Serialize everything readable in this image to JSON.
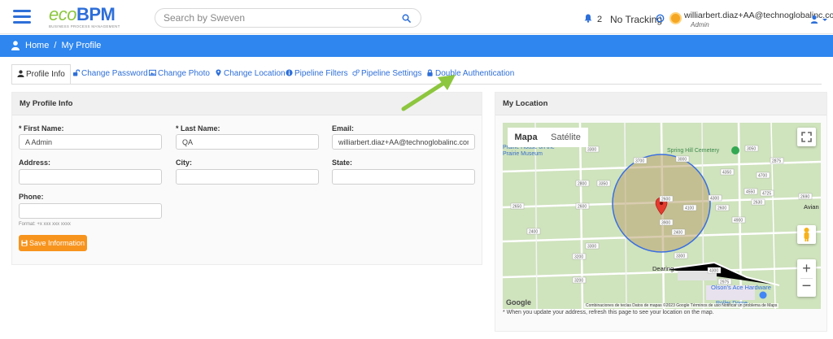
{
  "header": {
    "logo_main_eco": "eco",
    "logo_main_bpm": "BPM",
    "logo_sub": "BUSINESS PROCESS MANAGEMENT",
    "search_placeholder": "Search by Sweven",
    "notification_count": "2",
    "tracking_label": "No Tracking",
    "user_email": "williarbert.diaz+AA@technoglobalinc.com",
    "user_role": "Admin",
    "colors": {
      "brand_blue": "#2e6fd8",
      "brand_green": "#8cc63f",
      "bar_blue": "#2e86ee"
    }
  },
  "breadcrumb": {
    "home": "Home",
    "separator": "/",
    "current": "My Profile"
  },
  "tabs": [
    {
      "label": "Profile Info",
      "icon": "user-icon",
      "active": true
    },
    {
      "label": "Change Password",
      "icon": "key-icon"
    },
    {
      "label": "Change Photo",
      "icon": "image-icon"
    },
    {
      "label": "Change Location",
      "icon": "map-marker-icon"
    },
    {
      "label": "Pipeline Filters",
      "icon": "info-circle-icon"
    },
    {
      "label": "Pipeline Settings",
      "icon": "gears-icon"
    },
    {
      "label": "Double Authentication",
      "icon": "lock-icon"
    }
  ],
  "profile": {
    "title": "My Profile Info",
    "first_name_label": "* First Name:",
    "first_name_value": "A Admin",
    "last_name_label": "* Last Name:",
    "last_name_value": "QA",
    "email_label": "Email:",
    "email_value": "williarbert.diaz+AA@technoglobalinc.com",
    "address_label": "Address:",
    "address_value": "",
    "city_label": "City:",
    "city_value": "",
    "state_label": "State:",
    "state_value": "",
    "phone_label": "Phone:",
    "phone_value": "",
    "phone_hint": "Format: +x xxx xxx xxxx",
    "save_label": "Save Information"
  },
  "location": {
    "title": "My Location",
    "map_tab": "Mapa",
    "satellite_tab": "Satélite",
    "place_labels": [
      "Spring Hill Cemetery",
      "Dearing",
      "Olson's Ace Hardware",
      "Avian",
      "Roller Dome",
      "Prairie House on the",
      "Prairie Museum"
    ],
    "road_labels": [
      "3300",
      "3000",
      "3100",
      "3050",
      "2875",
      "4350",
      "4700",
      "2800",
      "3350",
      "2600",
      "4550",
      "4725",
      "2690",
      "2650",
      "2600",
      "4300",
      "2600",
      "4100",
      "2630",
      "4900",
      "3900",
      "2400",
      "2400",
      "3300",
      "3200",
      "3300",
      "4300",
      "3200",
      "2975"
    ],
    "google_label": "Google",
    "attribution": "Combinaciones de teclas   Datos de mapas ©2023 Google   Términos de uso   Notificar un problema de Maps",
    "note": "* When you update your address, refresh this page to see your location on the map."
  }
}
